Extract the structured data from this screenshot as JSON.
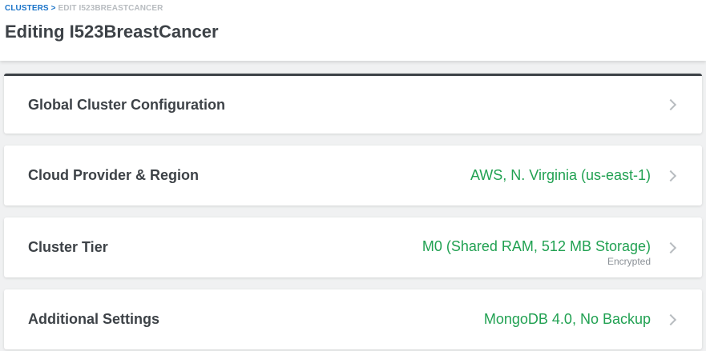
{
  "breadcrumb": {
    "parent": "CLUSTERS",
    "separator": ">",
    "current": "EDIT I523BREASTCANCER"
  },
  "page_title": "Editing I523BreastCancer",
  "sections": [
    {
      "title": "Global Cluster Configuration",
      "value": null,
      "sub": null
    },
    {
      "title": "Cloud Provider & Region",
      "value": "AWS, N. Virginia (us-east-1)",
      "sub": null
    },
    {
      "title": "Cluster Tier",
      "value": "M0 (Shared RAM, 512 MB Storage)",
      "sub": "Encrypted"
    },
    {
      "title": "Additional Settings",
      "value": "MongoDB 4.0, No Backup",
      "sub": null
    }
  ]
}
